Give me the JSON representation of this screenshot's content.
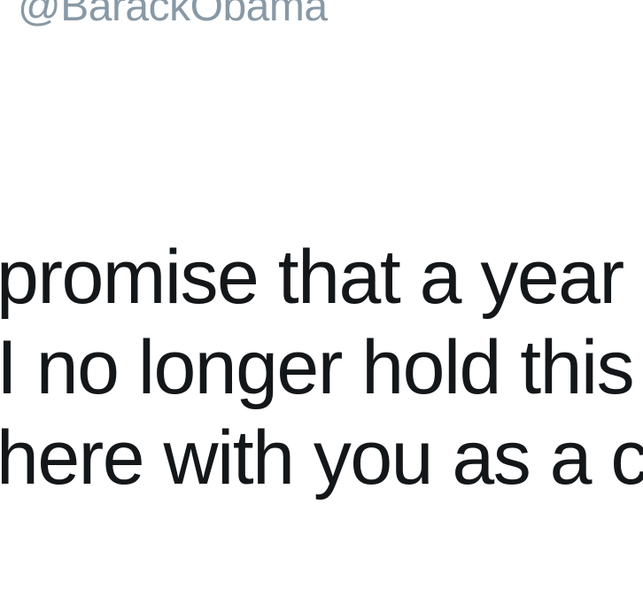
{
  "tweet": {
    "handle": "@BarackObama",
    "lines": [
      "promise that a year from n",
      "I no longer hold this office,",
      "here with you as a citizen.\""
    ]
  }
}
